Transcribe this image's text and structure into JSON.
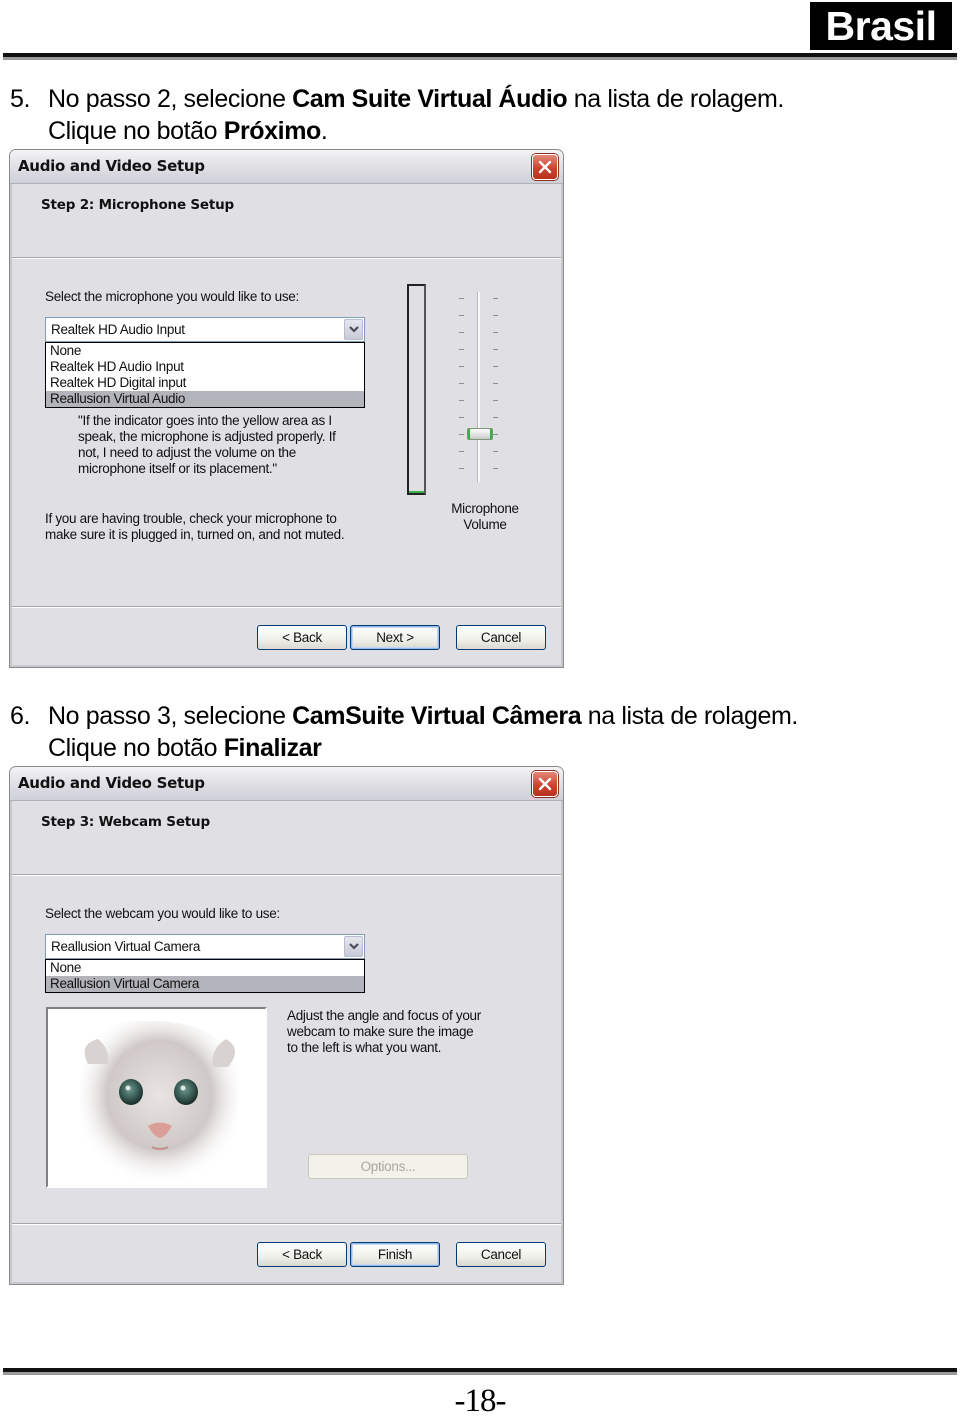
{
  "page": {
    "region_badge": "Brasil",
    "page_number": "-18-"
  },
  "instructions": [
    {
      "number": "5.",
      "line1_before": "No passo 2, selecione ",
      "line1_bold": "Cam Suite Virtual Áudio",
      "line1_after": " na lista de rolagem.",
      "line2_before": "Clique no botão ",
      "line2_bold": "Próximo",
      "line2_after": "."
    },
    {
      "number": "6.",
      "line1_before": "No passo 3, selecione ",
      "line1_bold": "CamSuite Virtual Câmera",
      "line1_after": " na lista de rolagem.",
      "line2_before": "Clique no botão ",
      "line2_bold": "Finalizar",
      "line2_after": ""
    }
  ],
  "dialogs": [
    {
      "title": "Audio and Video Setup",
      "step_title": "Step 2: Microphone Setup",
      "select_label": "Select the microphone you would like to use:",
      "combo_value": "Realtek HD Audio Input",
      "options": [
        "None",
        "Realtek HD Audio Input",
        "Realtek HD Digital input",
        "Reallusion Virtual Audio"
      ],
      "highlighted_option": "Reallusion Virtual Audio",
      "quote": "\"If the indicator goes into the yellow area as I speak, the microphone is adjusted properly.  If not, I need to adjust the volume on the microphone itself or its placement.\"",
      "quote_lines": [
        "\"If the indicator goes into the yellow area as I",
        "speak, the microphone is adjusted properly.  If",
        "not, I need to adjust the volume on the",
        "microphone itself or its placement.\""
      ],
      "trouble_lines": [
        "If you are having trouble, check your microphone to",
        "make sure it is plugged in, turned on, and not muted."
      ],
      "volume_label_lines": [
        "Microphone",
        "Volume"
      ],
      "input_level_percent": 1,
      "volume_slider_percent": 20,
      "buttons": {
        "back": "< Back",
        "next": "Next >",
        "cancel": "Cancel"
      }
    },
    {
      "title": "Audio and Video Setup",
      "step_title": "Step 3: Webcam Setup",
      "select_label": "Select the webcam you would like to use:",
      "combo_value": "Reallusion Virtual Camera",
      "options": [
        "None",
        "Reallusion Virtual Camera"
      ],
      "highlighted_option": "Reallusion Virtual Camera",
      "preview_image": "kitten-face-webcam-preview",
      "adjust_lines": [
        "Adjust the angle and focus of your",
        "webcam to make sure the image",
        "to the left is what you want."
      ],
      "options_button": "Options...",
      "buttons": {
        "back": "< Back",
        "finish": "Finish",
        "cancel": "Cancel"
      }
    }
  ],
  "colors": {
    "dialog_bg": "#e0dfe3",
    "selected_option_bg": "#b3b3bb",
    "close_button_red": "#c9402b",
    "level_green": "#3cb04a"
  }
}
